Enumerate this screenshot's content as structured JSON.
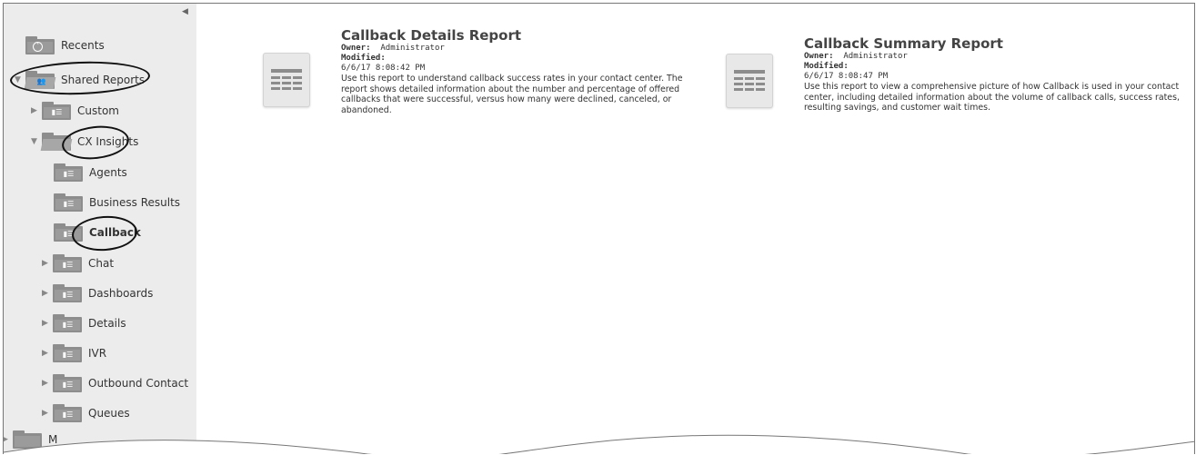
{
  "sidebar": {
    "collapse_icon": "triangle-left",
    "recents_label": "Recents",
    "shared_reports_label": "Shared Reports",
    "custom_label": "Custom",
    "cx_insights_label": "CX Insights",
    "agents_label": "Agents",
    "business_results_label": "Business Results",
    "callback_label": "Callback",
    "chat_label": "Chat",
    "dashboards_label": "Dashboards",
    "details_label": "Details",
    "ivr_label": "IVR",
    "outbound_contact_label": "Outbound Contact",
    "queues_label": "Queues",
    "truncated_label": "M"
  },
  "reports": [
    {
      "title": "Callback Details Report",
      "owner_label": "Owner:",
      "owner": "Administrator",
      "modified_label": "Modified:",
      "modified": "6/6/17 8:08:42 PM",
      "description": "Use this report to understand callback success rates in your contact center. The report shows detailed information about the number and percentage of offered callbacks that were successful, versus how many were declined, canceled, or abandoned."
    },
    {
      "title": "Callback Summary Report",
      "owner_label": "Owner:",
      "owner": "Administrator",
      "modified_label": "Modified:",
      "modified": "6/6/17 8:08:47 PM",
      "description": "Use this report to view a comprehensive picture of how Callback is used in your contact center, including detailed information about the volume of callback calls, success rates, resulting savings, and customer wait times."
    }
  ],
  "colors": {
    "sidebar_bg": "#ececec",
    "folder": "#8d8d8d",
    "annotation": "#111111"
  }
}
